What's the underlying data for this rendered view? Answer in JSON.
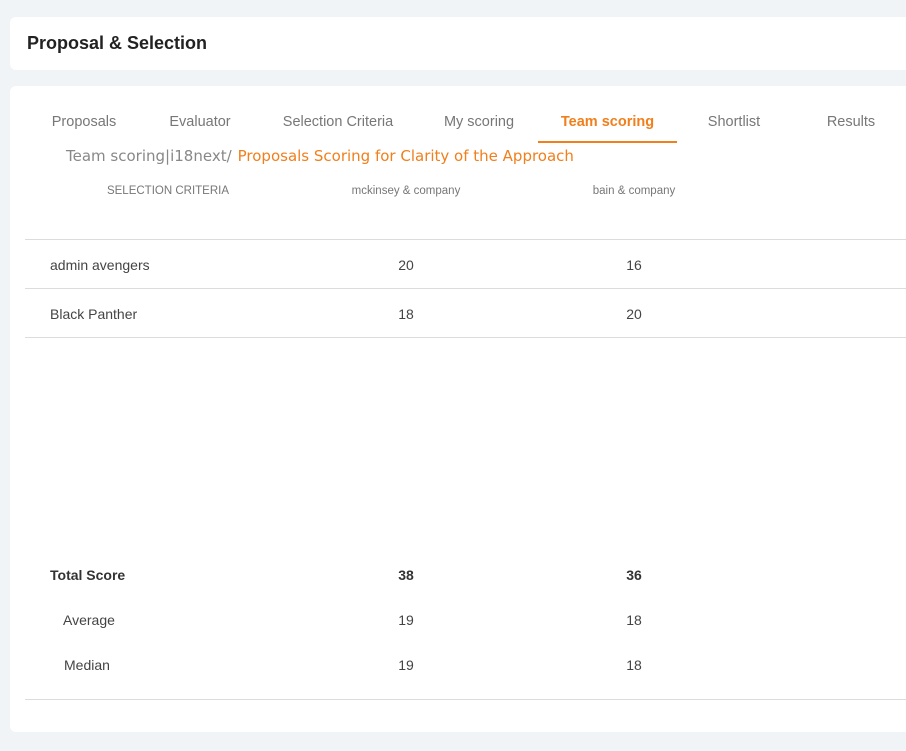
{
  "header": {
    "title": "Proposal & Selection"
  },
  "tabs": [
    {
      "label": "Proposals",
      "active": false
    },
    {
      "label": "Evaluator",
      "active": false
    },
    {
      "label": "Selection Criteria",
      "active": false
    },
    {
      "label": "My scoring",
      "active": false
    },
    {
      "label": "Team scoring",
      "active": true
    },
    {
      "label": "Shortlist",
      "active": false
    },
    {
      "label": "Results",
      "active": false
    }
  ],
  "breadcrumb": {
    "root": "Team scoring",
    "separator": "|",
    "sub": "i18next/",
    "current": "Proposals Scoring for Clarity of the Approach"
  },
  "table": {
    "columns": [
      "SELECTION CRITERIA",
      "mckinsey & company",
      "bain & company"
    ],
    "rows": [
      {
        "name": "admin avengers",
        "values": [
          "20",
          "16"
        ]
      },
      {
        "name": "Black Panther",
        "values": [
          "18",
          "20"
        ]
      }
    ],
    "summary": [
      {
        "label": "Total Score",
        "values": [
          "38",
          "36"
        ]
      },
      {
        "label": "Average",
        "values": [
          "19",
          "18"
        ]
      },
      {
        "label": "Median",
        "values": [
          "19",
          "18"
        ]
      }
    ]
  },
  "colors": {
    "accent": "#f07f1c",
    "background": "#f1f4f7"
  }
}
